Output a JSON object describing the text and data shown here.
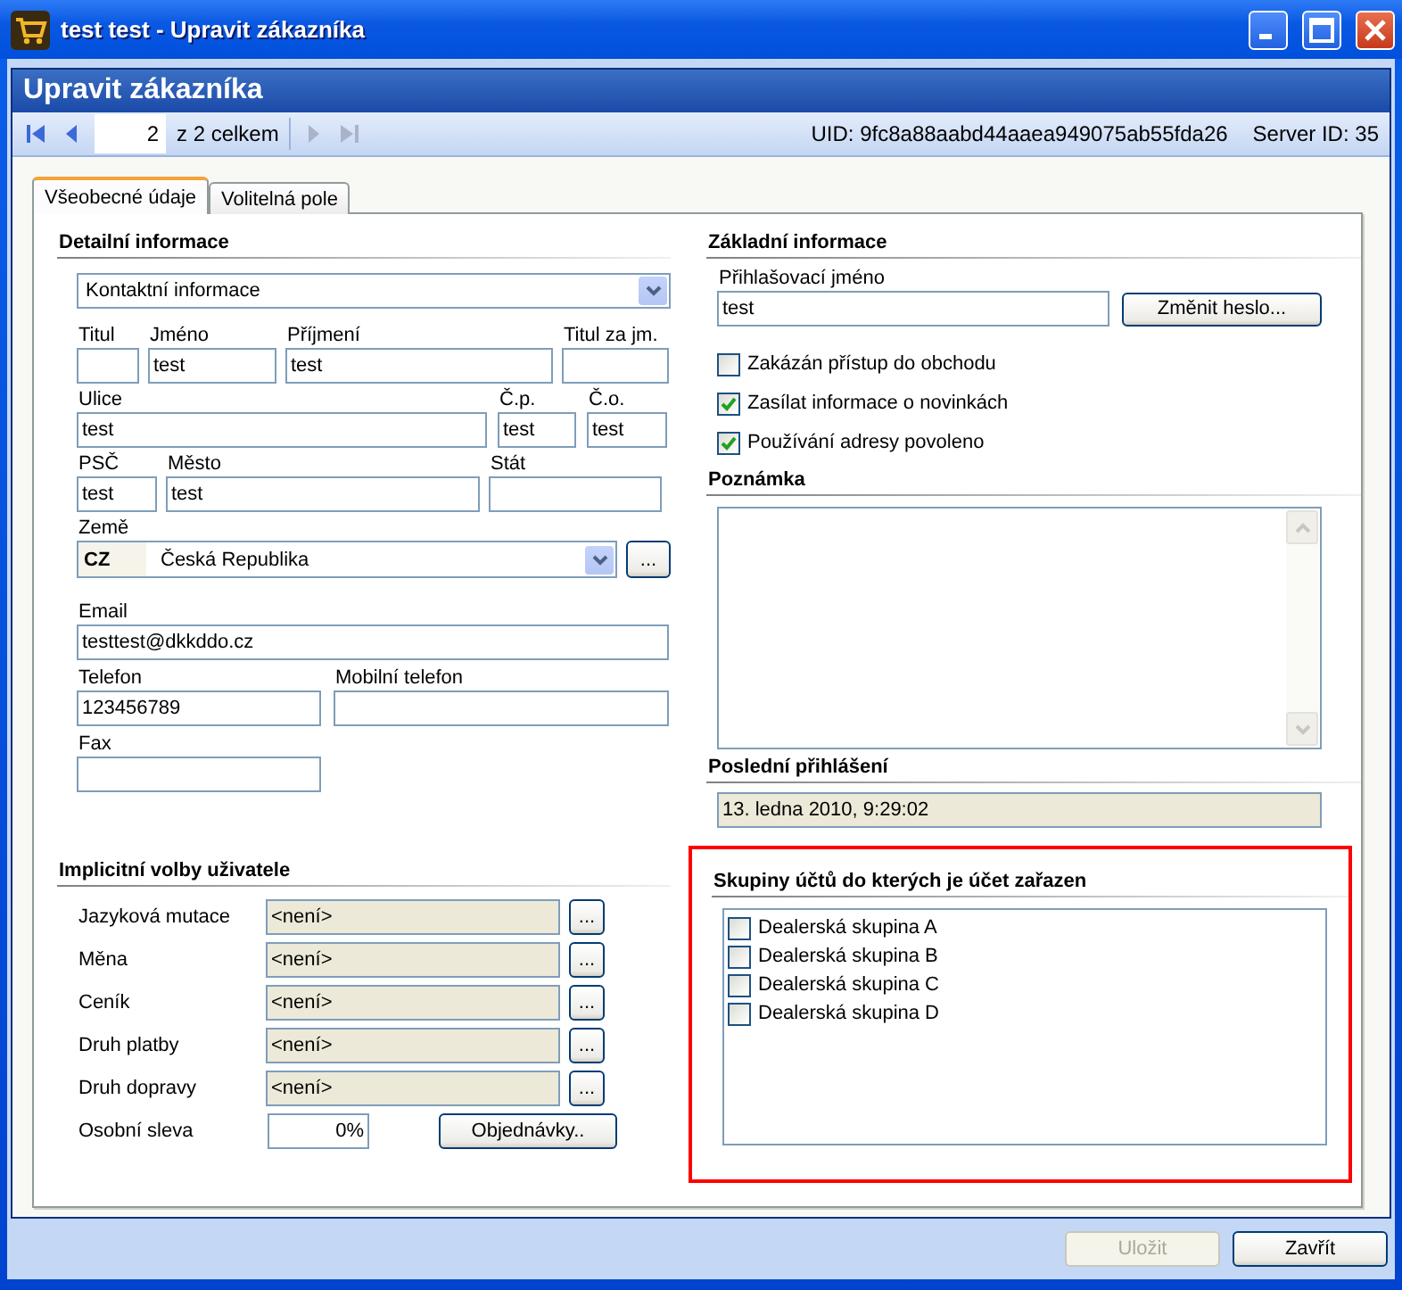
{
  "window": {
    "title": "test test - Upravit zákazníka"
  },
  "header": {
    "title": "Upravit zákazníka"
  },
  "navigator": {
    "record": "2",
    "total": "z 2 celkem",
    "uid": "UID: 9fc8a88aabd44aaea949075ab55fda26",
    "server_id": "Server ID: 35"
  },
  "tabs": [
    {
      "label": "Všeobecné údaje",
      "selected": true
    },
    {
      "label": "Volitelná pole",
      "selected": false
    }
  ],
  "detail": {
    "title": "Detailní informace",
    "section": "Kontaktní informace",
    "fields": [
      {
        "label": "Titul"
      },
      {
        "label": "Jméno",
        "value": "test"
      },
      {
        "label": "Příjmení",
        "value": "test"
      },
      {
        "label": "Titul za jm."
      },
      {
        "label": "Ulice",
        "value": "test"
      },
      {
        "label": "Č.p.",
        "value": "test"
      },
      {
        "label": "Č.o.",
        "value": "test"
      },
      {
        "label": "PSČ",
        "value": "test"
      },
      {
        "label": "Město",
        "value": "test"
      },
      {
        "label": "Stát"
      }
    ],
    "country": {
      "label": "Země",
      "code": "CZ",
      "value": "Česká Republika",
      "button": "..."
    },
    "contact_fields": [
      {
        "label": "Email",
        "value": "testtest@dkkddo.cz"
      },
      {
        "label": "Telefon",
        "value": "123456789"
      },
      {
        "label": "Mobilní telefon"
      },
      {
        "label": "Fax"
      }
    ]
  },
  "defaults": {
    "title": "Implicitní volby uživatele",
    "rows": [
      {
        "label": "Jazyková mutace",
        "value": "<není>",
        "button": "..."
      },
      {
        "label": "Měna",
        "value": "<není>",
        "button": "..."
      },
      {
        "label": "Ceník",
        "value": "<není>",
        "button": "..."
      },
      {
        "label": "Druh platby",
        "value": "<není>",
        "button": "..."
      },
      {
        "label": "Druh dopravy",
        "value": "<není>",
        "button": "..."
      }
    ],
    "discount": {
      "label": "Osobní sleva",
      "value": "0%"
    },
    "orders_button": "Objednávky.."
  },
  "basic": {
    "title": "Základní informace",
    "login_label": "Přihlašovací jméno",
    "login_value": "test",
    "password_button": "Změnit heslo...",
    "checkboxes": [
      {
        "label": "Zakázán přístup do obchodu",
        "checked": false
      },
      {
        "label": "Zasílat informace o novinkách",
        "checked": true
      },
      {
        "label": "Používání adresy povoleno",
        "checked": true
      }
    ]
  },
  "note": {
    "title": "Poznámka"
  },
  "last_login": {
    "title": "Poslední přihlášení",
    "value": "13. ledna 2010, 9:29:02"
  },
  "groups": {
    "title": "Skupiny účtů do kterých je účet zařazen",
    "highlighted": true,
    "items": [
      {
        "label": "Dealerská skupina A",
        "checked": false
      },
      {
        "label": "Dealerská skupina B",
        "checked": false
      },
      {
        "label": "Dealerská skupina C",
        "checked": false
      },
      {
        "label": "Dealerská skupina D",
        "checked": false
      }
    ]
  },
  "footer": {
    "buttons": [
      {
        "label": "Uložit",
        "disabled": true
      },
      {
        "label": "Zavřít",
        "disabled": false
      }
    ]
  }
}
